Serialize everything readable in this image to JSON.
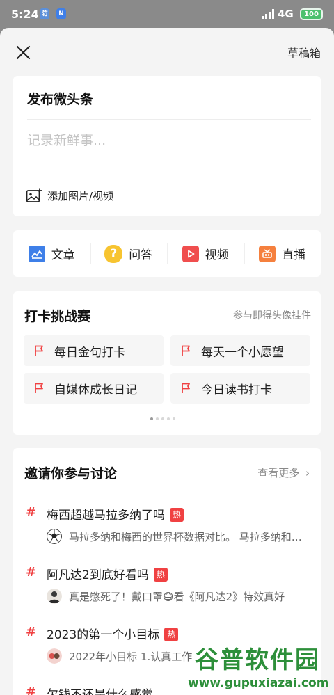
{
  "status_bar": {
    "time": "5:24",
    "network": "4G",
    "battery": "100"
  },
  "header": {
    "drafts_label": "草稿箱"
  },
  "compose": {
    "title": "发布微头条",
    "placeholder": "记录新鲜事...",
    "media_label": "添加图片/视频"
  },
  "post_types": [
    {
      "label": "文章",
      "icon": "article-icon",
      "color": "#3e7fe8"
    },
    {
      "label": "问答",
      "icon": "question-icon",
      "color": "#f7c430"
    },
    {
      "label": "视频",
      "icon": "video-icon",
      "color": "#f04e4e"
    },
    {
      "label": "直播",
      "icon": "live-icon",
      "color": "#f5803e"
    }
  ],
  "challenge": {
    "title": "打卡挑战赛",
    "link": "参与即得头像挂件",
    "items": [
      "每日金句打卡",
      "每天一个小愿望",
      "自媒体成长日记",
      "今日读书打卡"
    ]
  },
  "discussion": {
    "title": "邀请你参与讨论",
    "more": "查看更多",
    "topics": [
      {
        "title": "梅西超越马拉多纳了吗",
        "badge": "热",
        "desc": "马拉多纳和梅西的世界杯数据对比。 马拉多纳和梅西"
      },
      {
        "title": "阿凡达2到底好看吗",
        "badge": "热",
        "desc": "真是憋死了！戴口罩😷看《阿凡达2》特效真好"
      },
      {
        "title": "2023的第一个小目标",
        "badge": "热",
        "desc": "2022年小目标 1.认真工作"
      },
      {
        "title": "欠钱不还是什么感觉",
        "badge": "",
        "desc": ""
      }
    ]
  },
  "watermark": {
    "name": "谷普软件园",
    "url": "www.gupuxiazai.com"
  },
  "colors": {
    "accent_red": "#f04142",
    "background": "#f4f4f4"
  }
}
